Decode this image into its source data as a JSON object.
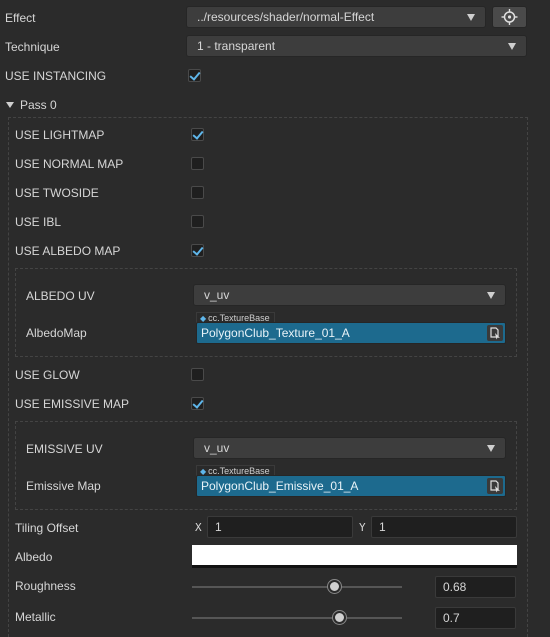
{
  "effect": {
    "label": "Effect",
    "value": "../resources/shader/normal-Effect",
    "locate_icon": "crosshair-icon"
  },
  "technique": {
    "label": "Technique",
    "value": "1 - transparent"
  },
  "use_instancing": {
    "label": "USE INSTANCING",
    "checked": true
  },
  "pass": {
    "label": "Pass 0",
    "expanded": true
  },
  "flags": {
    "lightmap": {
      "label": "USE LIGHTMAP",
      "checked": true
    },
    "normal_map": {
      "label": "USE NORMAL MAP",
      "checked": false
    },
    "twoside": {
      "label": "USE TWOSIDE",
      "checked": false
    },
    "ibl": {
      "label": "USE IBL",
      "checked": false
    },
    "albedo_map": {
      "label": "USE ALBEDO MAP",
      "checked": true
    },
    "glow": {
      "label": "USE GLOW",
      "checked": false
    },
    "emissive_map": {
      "label": "USE EMISSIVE MAP",
      "checked": true
    }
  },
  "albedo_group": {
    "uv_label": "ALBEDO UV",
    "uv_value": "v_uv",
    "map_label": "AlbedoMap",
    "map_type": "cc.TextureBase",
    "map_value": "PolygonClub_Texture_01_A"
  },
  "emissive_group": {
    "uv_label": "EMISSIVE UV",
    "uv_value": "v_uv",
    "map_label": "Emissive Map",
    "map_type": "cc.TextureBase",
    "map_value": "PolygonClub_Emissive_01_A"
  },
  "tiling_offset": {
    "label": "Tiling Offset",
    "x_label": "X",
    "x_value": "1",
    "y_label": "Y",
    "y_value": "1"
  },
  "albedo": {
    "label": "Albedo",
    "color": "#ffffff"
  },
  "roughness": {
    "label": "Roughness",
    "value": "0.68",
    "fraction": 0.68
  },
  "metallic": {
    "label": "Metallic",
    "value": "0.7",
    "fraction": 0.7
  },
  "colors": {
    "accent": "#5fb6ea",
    "asset_field": "#1d6a8e"
  }
}
